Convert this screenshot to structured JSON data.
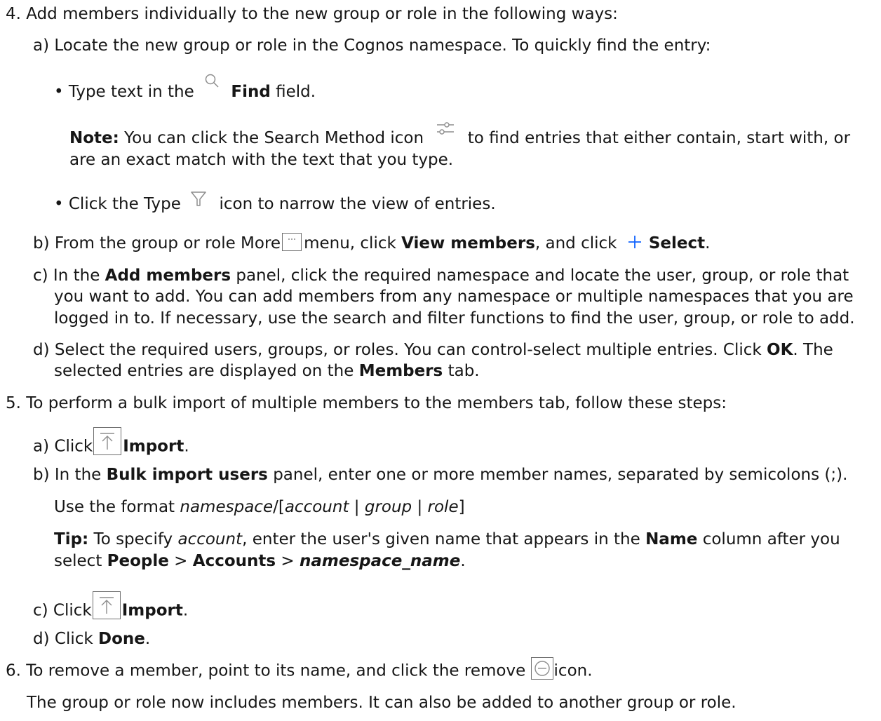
{
  "steps": {
    "step4": {
      "intro": "4. Add members individually to the new group or role in the following ways:",
      "a": {
        "text": "a) Locate the new group or role in the Cognos namespace. To quickly find the entry:",
        "bullet1_pre": "• Type text in the",
        "bullet1_bold": "Find",
        "bullet1_post": "field.",
        "note_label": "Note:",
        "note_pre": "You can click the Search Method icon",
        "note_post": "to find entries that either contain, start with, or",
        "note_line2": "are an exact match with the text that you type.",
        "bullet2_pre": "• Click the Type",
        "bullet2_post": "icon to narrow the view of entries."
      },
      "b": {
        "pre": "b) From the group or role More",
        "mid": "menu, click",
        "bold1": "View members",
        "mid2": ", and click",
        "bold2": "Select",
        "end": "."
      },
      "c": {
        "pre": "c) In the",
        "bold": "Add members",
        "post": "panel, click the required namespace and locate the user, group, or role that",
        "line2": "you want to add. You can add members from any namespace or multiple namespaces that you are",
        "line3": "logged in to. If necessary, use the search and filter functions to find the user, group, or role to add."
      },
      "d": {
        "pre": "d) Select the required users, groups, or roles. You can control-select multiple entries. Click",
        "bold": "OK",
        "post": ". The",
        "line2_pre": "selected entries are displayed on the",
        "line2_bold": "Members",
        "line2_post": "tab."
      }
    },
    "step5": {
      "intro": "5. To perform a bulk import of multiple members to the members tab, follow these steps:",
      "a": {
        "pre": "a) Click",
        "bold": "Import",
        "end": "."
      },
      "b": {
        "pre": "b) In the",
        "bold": "Bulk import users",
        "post": "panel, enter one or more member names, separated by semicolons (;).",
        "format_pre": "Use the format",
        "format_ns": "namespace",
        "format_slash": "/[",
        "format_account": "account",
        "format_sep1": " | ",
        "format_group": "group",
        "format_sep2": " | ",
        "format_role": "role",
        "format_end": "]",
        "tip_label": "Tip:",
        "tip_pre": "To specify",
        "tip_account": "account",
        "tip_mid": ", enter the user's given name that appears in the",
        "tip_name": "Name",
        "tip_post": "column after you",
        "tip2_pre": "select",
        "tip2_people": "People",
        "tip2_gt1": " > ",
        "tip2_accounts": "Accounts",
        "tip2_gt2": " > ",
        "tip2_ns": "namespace_name",
        "tip2_end": "."
      },
      "c": {
        "pre": "c) Click",
        "bold": "Import",
        "end": "."
      },
      "d": {
        "pre": "d) Click",
        "bold": "Done",
        "end": "."
      }
    },
    "step6": {
      "text_pre": "6. To remove a member, point to its name, and click the remove",
      "text_post": "icon.",
      "result": "The group or role now includes members. It can also be added to another group or role."
    }
  },
  "icons": {
    "find": "search-icon",
    "search_method": "sliders-icon",
    "type": "filter-icon",
    "more": "overflow-menu-icon",
    "select": "add-icon",
    "import": "upload-icon",
    "remove": "remove-circle-icon"
  },
  "colors": {
    "text": "#161616",
    "accent": "#0f62fe",
    "icon": "#8d8d8d"
  }
}
